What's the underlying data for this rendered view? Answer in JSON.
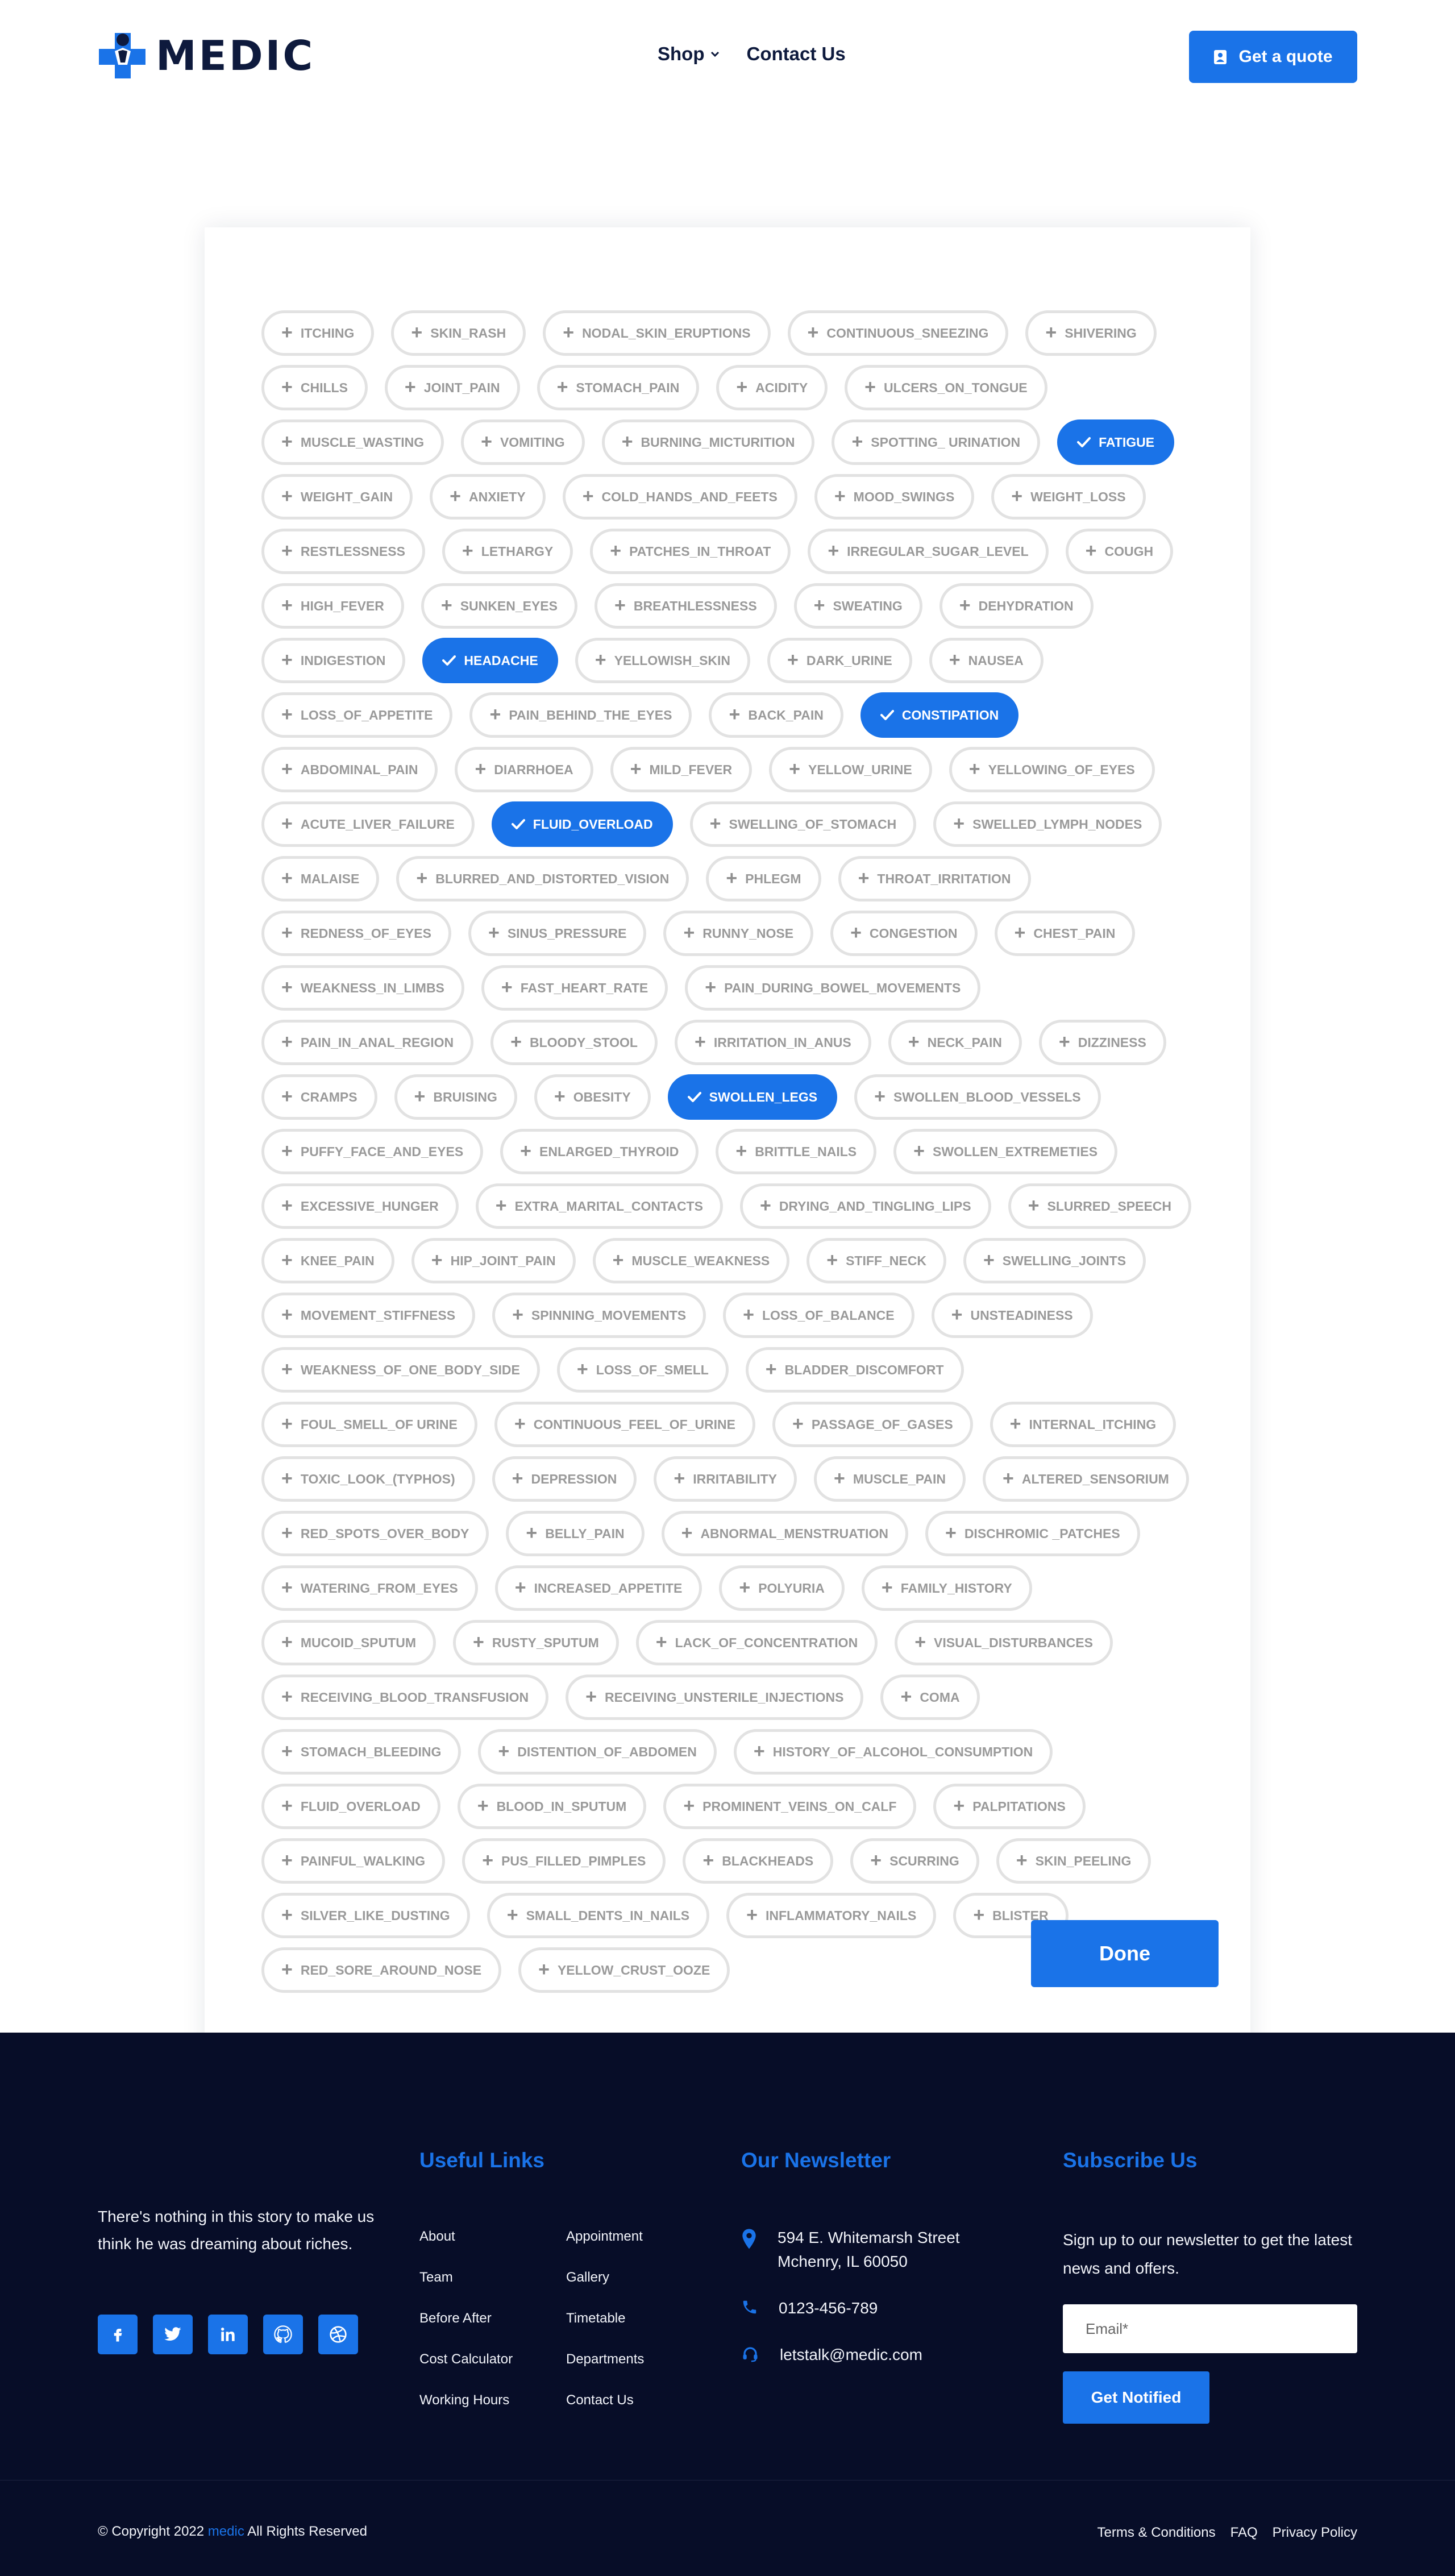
{
  "header": {
    "brand": "MEDIC",
    "nav": [
      {
        "label": "Shop",
        "has_dropdown": true
      },
      {
        "label": "Contact Us",
        "has_dropdown": false
      }
    ],
    "quote_button": "Get a quote"
  },
  "symptoms": [
    {
      "label": "ITCHING",
      "selected": false
    },
    {
      "label": "SKIN_RASH",
      "selected": false
    },
    {
      "label": "NODAL_SKIN_ERUPTIONS",
      "selected": false
    },
    {
      "label": "CONTINUOUS_SNEEZING",
      "selected": false
    },
    {
      "label": "SHIVERING",
      "selected": false
    },
    {
      "label": "CHILLS",
      "selected": false
    },
    {
      "label": "JOINT_PAIN",
      "selected": false
    },
    {
      "label": "STOMACH_PAIN",
      "selected": false
    },
    {
      "label": "ACIDITY",
      "selected": false
    },
    {
      "label": "ULCERS_ON_TONGUE",
      "selected": false
    },
    {
      "label": "MUSCLE_WASTING",
      "selected": false
    },
    {
      "label": "VOMITING",
      "selected": false
    },
    {
      "label": "BURNING_MICTURITION",
      "selected": false
    },
    {
      "label": "SPOTTING_ URINATION",
      "selected": false
    },
    {
      "label": "FATIGUE",
      "selected": true
    },
    {
      "label": "WEIGHT_GAIN",
      "selected": false
    },
    {
      "label": "ANXIETY",
      "selected": false
    },
    {
      "label": "COLD_HANDS_AND_FEETS",
      "selected": false
    },
    {
      "label": "MOOD_SWINGS",
      "selected": false
    },
    {
      "label": "WEIGHT_LOSS",
      "selected": false
    },
    {
      "label": "RESTLESSNESS",
      "selected": false
    },
    {
      "label": "LETHARGY",
      "selected": false
    },
    {
      "label": "PATCHES_IN_THROAT",
      "selected": false
    },
    {
      "label": "IRREGULAR_SUGAR_LEVEL",
      "selected": false
    },
    {
      "label": "COUGH",
      "selected": false
    },
    {
      "label": "HIGH_FEVER",
      "selected": false
    },
    {
      "label": "SUNKEN_EYES",
      "selected": false
    },
    {
      "label": "BREATHLESSNESS",
      "selected": false
    },
    {
      "label": "SWEATING",
      "selected": false
    },
    {
      "label": "DEHYDRATION",
      "selected": false
    },
    {
      "label": "INDIGESTION",
      "selected": false
    },
    {
      "label": "HEADACHE",
      "selected": true
    },
    {
      "label": "YELLOWISH_SKIN",
      "selected": false
    },
    {
      "label": "DARK_URINE",
      "selected": false
    },
    {
      "label": "NAUSEA",
      "selected": false
    },
    {
      "label": "LOSS_OF_APPETITE",
      "selected": false
    },
    {
      "label": "PAIN_BEHIND_THE_EYES",
      "selected": false
    },
    {
      "label": "BACK_PAIN",
      "selected": false
    },
    {
      "label": "CONSTIPATION",
      "selected": true
    },
    {
      "label": "ABDOMINAL_PAIN",
      "selected": false
    },
    {
      "label": "DIARRHOEA",
      "selected": false
    },
    {
      "label": "MILD_FEVER",
      "selected": false
    },
    {
      "label": "YELLOW_URINE",
      "selected": false
    },
    {
      "label": "YELLOWING_OF_EYES",
      "selected": false
    },
    {
      "label": "ACUTE_LIVER_FAILURE",
      "selected": false
    },
    {
      "label": "FLUID_OVERLOAD",
      "selected": true
    },
    {
      "label": "SWELLING_OF_STOMACH",
      "selected": false
    },
    {
      "label": "SWELLED_LYMPH_NODES",
      "selected": false
    },
    {
      "label": "MALAISE",
      "selected": false
    },
    {
      "label": "BLURRED_AND_DISTORTED_VISION",
      "selected": false
    },
    {
      "label": "PHLEGM",
      "selected": false
    },
    {
      "label": "THROAT_IRRITATION",
      "selected": false
    },
    {
      "label": "REDNESS_OF_EYES",
      "selected": false
    },
    {
      "label": "SINUS_PRESSURE",
      "selected": false
    },
    {
      "label": "RUNNY_NOSE",
      "selected": false
    },
    {
      "label": "CONGESTION",
      "selected": false
    },
    {
      "label": "CHEST_PAIN",
      "selected": false
    },
    {
      "label": "WEAKNESS_IN_LIMBS",
      "selected": false
    },
    {
      "label": "FAST_HEART_RATE",
      "selected": false
    },
    {
      "label": "PAIN_DURING_BOWEL_MOVEMENTS",
      "selected": false
    },
    {
      "label": "PAIN_IN_ANAL_REGION",
      "selected": false
    },
    {
      "label": "BLOODY_STOOL",
      "selected": false
    },
    {
      "label": "IRRITATION_IN_ANUS",
      "selected": false
    },
    {
      "label": "NECK_PAIN",
      "selected": false
    },
    {
      "label": "DIZZINESS",
      "selected": false
    },
    {
      "label": "CRAMPS",
      "selected": false
    },
    {
      "label": "BRUISING",
      "selected": false
    },
    {
      "label": "OBESITY",
      "selected": false
    },
    {
      "label": "SWOLLEN_LEGS",
      "selected": true
    },
    {
      "label": "SWOLLEN_BLOOD_VESSELS",
      "selected": false
    },
    {
      "label": "PUFFY_FACE_AND_EYES",
      "selected": false
    },
    {
      "label": "ENLARGED_THYROID",
      "selected": false
    },
    {
      "label": "BRITTLE_NAILS",
      "selected": false
    },
    {
      "label": "SWOLLEN_EXTREMETIES",
      "selected": false
    },
    {
      "label": "EXCESSIVE_HUNGER",
      "selected": false
    },
    {
      "label": "EXTRA_MARITAL_CONTACTS",
      "selected": false
    },
    {
      "label": "DRYING_AND_TINGLING_LIPS",
      "selected": false
    },
    {
      "label": "SLURRED_SPEECH",
      "selected": false
    },
    {
      "label": "KNEE_PAIN",
      "selected": false
    },
    {
      "label": "HIP_JOINT_PAIN",
      "selected": false
    },
    {
      "label": "MUSCLE_WEAKNESS",
      "selected": false
    },
    {
      "label": "STIFF_NECK",
      "selected": false
    },
    {
      "label": "SWELLING_JOINTS",
      "selected": false
    },
    {
      "label": "MOVEMENT_STIFFNESS",
      "selected": false
    },
    {
      "label": "SPINNING_MOVEMENTS",
      "selected": false
    },
    {
      "label": "LOSS_OF_BALANCE",
      "selected": false
    },
    {
      "label": "UNSTEADINESS",
      "selected": false
    },
    {
      "label": "WEAKNESS_OF_ONE_BODY_SIDE",
      "selected": false
    },
    {
      "label": "LOSS_OF_SMELL",
      "selected": false
    },
    {
      "label": "BLADDER_DISCOMFORT",
      "selected": false
    },
    {
      "label": "FOUL_SMELL_OF URINE",
      "selected": false
    },
    {
      "label": "CONTINUOUS_FEEL_OF_URINE",
      "selected": false
    },
    {
      "label": "PASSAGE_OF_GASES",
      "selected": false
    },
    {
      "label": "INTERNAL_ITCHING",
      "selected": false
    },
    {
      "label": "TOXIC_LOOK_(TYPHOS)",
      "selected": false
    },
    {
      "label": "DEPRESSION",
      "selected": false
    },
    {
      "label": "IRRITABILITY",
      "selected": false
    },
    {
      "label": "MUSCLE_PAIN",
      "selected": false
    },
    {
      "label": "ALTERED_SENSORIUM",
      "selected": false
    },
    {
      "label": "RED_SPOTS_OVER_BODY",
      "selected": false
    },
    {
      "label": "BELLY_PAIN",
      "selected": false
    },
    {
      "label": "ABNORMAL_MENSTRUATION",
      "selected": false
    },
    {
      "label": "DISCHROMIC _PATCHES",
      "selected": false
    },
    {
      "label": "WATERING_FROM_EYES",
      "selected": false
    },
    {
      "label": "INCREASED_APPETITE",
      "selected": false
    },
    {
      "label": "POLYURIA",
      "selected": false
    },
    {
      "label": "FAMILY_HISTORY",
      "selected": false
    },
    {
      "label": "MUCOID_SPUTUM",
      "selected": false
    },
    {
      "label": "RUSTY_SPUTUM",
      "selected": false
    },
    {
      "label": "LACK_OF_CONCENTRATION",
      "selected": false
    },
    {
      "label": "VISUAL_DISTURBANCES",
      "selected": false
    },
    {
      "label": "RECEIVING_BLOOD_TRANSFUSION",
      "selected": false
    },
    {
      "label": "RECEIVING_UNSTERILE_INJECTIONS",
      "selected": false
    },
    {
      "label": "COMA",
      "selected": false
    },
    {
      "label": "STOMACH_BLEEDING",
      "selected": false
    },
    {
      "label": "DISTENTION_OF_ABDOMEN",
      "selected": false
    },
    {
      "label": "HISTORY_OF_ALCOHOL_CONSUMPTION",
      "selected": false
    },
    {
      "label": "FLUID_OVERLOAD",
      "selected": false
    },
    {
      "label": "BLOOD_IN_SPUTUM",
      "selected": false
    },
    {
      "label": "PROMINENT_VEINS_ON_CALF",
      "selected": false
    },
    {
      "label": "PALPITATIONS",
      "selected": false
    },
    {
      "label": "PAINFUL_WALKING",
      "selected": false
    },
    {
      "label": "PUS_FILLED_PIMPLES",
      "selected": false
    },
    {
      "label": "BLACKHEADS",
      "selected": false
    },
    {
      "label": "SCURRING",
      "selected": false
    },
    {
      "label": "SKIN_PEELING",
      "selected": false
    },
    {
      "label": "SILVER_LIKE_DUSTING",
      "selected": false
    },
    {
      "label": "SMALL_DENTS_IN_NAILS",
      "selected": false
    },
    {
      "label": "INFLAMMATORY_NAILS",
      "selected": false
    },
    {
      "label": "BLISTER",
      "selected": false
    },
    {
      "label": "RED_SORE_AROUND_NOSE",
      "selected": false
    },
    {
      "label": "YELLOW_CRUST_OOZE",
      "selected": false
    }
  ],
  "done_button": "Done",
  "footer": {
    "tagline": "There's nothing in this story to make us think he was dreaming about riches.",
    "socials": [
      {
        "name": "facebook-icon"
      },
      {
        "name": "twitter-icon"
      },
      {
        "name": "linkedin-icon"
      },
      {
        "name": "github-icon"
      },
      {
        "name": "dribbble-icon"
      }
    ],
    "useful_links_title": "Useful Links",
    "links_col1": [
      "About",
      "Team",
      "Before After",
      "Cost Calculator",
      "Working Hours"
    ],
    "links_col2": [
      "Appointment",
      "Gallery",
      "Timetable",
      "Departments",
      "Contact Us"
    ],
    "newsletter_title": "Our Newsletter",
    "address_line1": "594 E. Whitemarsh Street",
    "address_line2": "Mchenry, IL 60050",
    "phone": "0123-456-789",
    "email": "letstalk@medic.com",
    "subscribe_title": "Subscribe Us",
    "subscribe_text": "Sign up to our newsletter to get the latest news and offers.",
    "email_placeholder": "Email*",
    "notify_button": "Get Notified",
    "copyright_prefix": "© Copyright 2022",
    "copyright_brand": "medic",
    "copyright_suffix": "All Rights Reserved",
    "legal_links": [
      "Terms & Conditions",
      "FAQ",
      "Privacy Policy"
    ]
  },
  "colors": {
    "accent": "#1a73e8",
    "footer_bg": "#070d28",
    "chip_border": "#e2e2e2",
    "chip_text": "#9a9a9a",
    "brand_dark": "#0e1a3d"
  }
}
